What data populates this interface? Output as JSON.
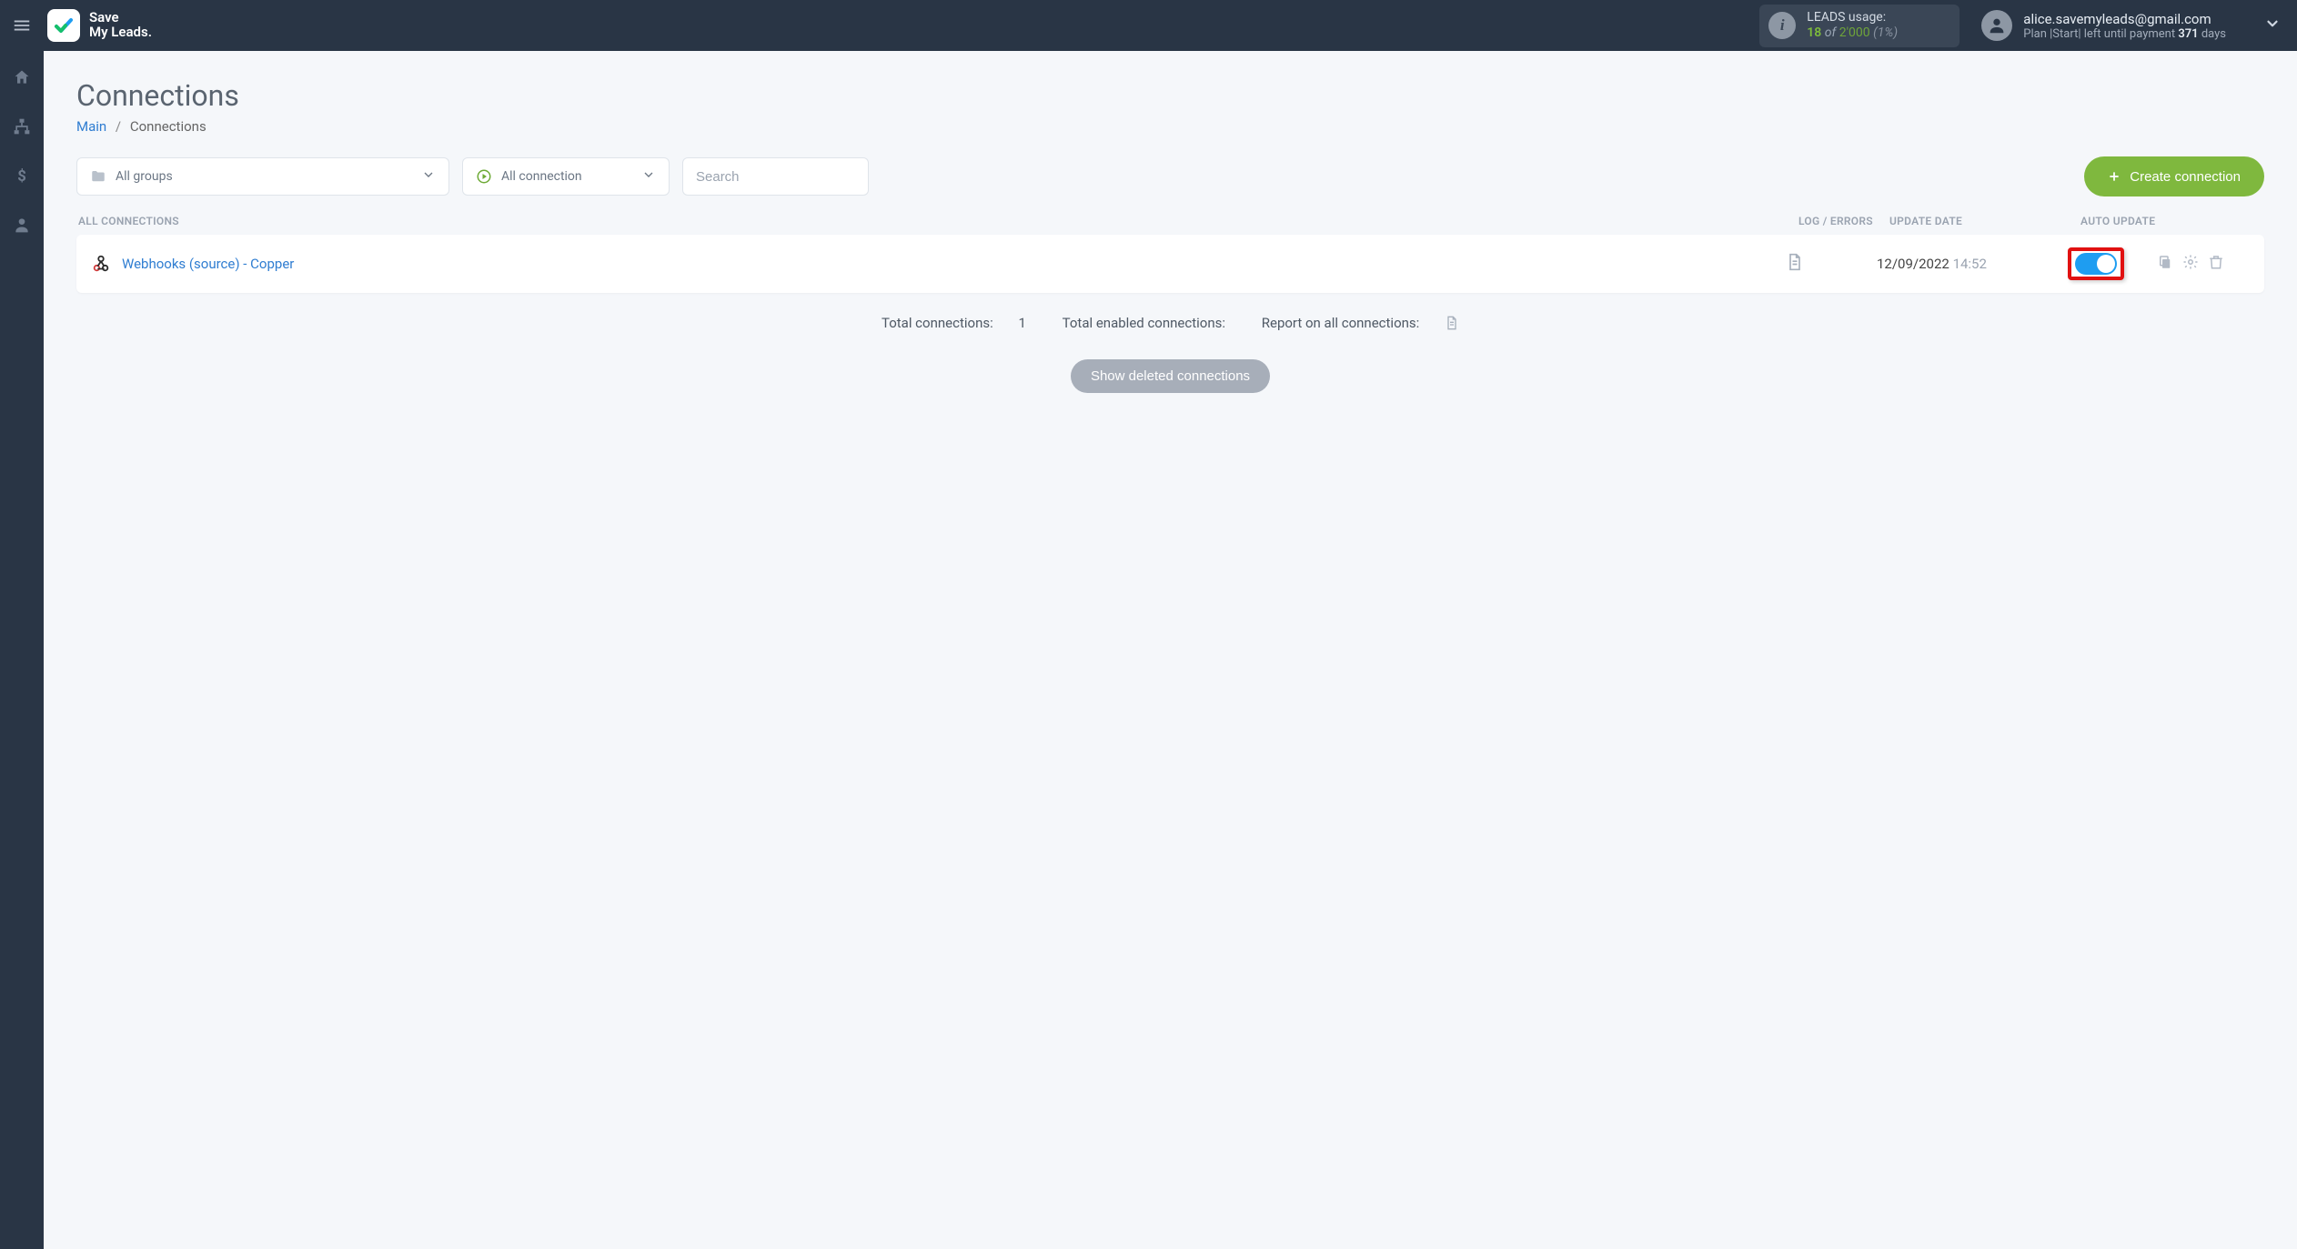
{
  "brand": {
    "line1": "Save",
    "line2": "My Leads."
  },
  "usage": {
    "label": "LEADS usage:",
    "used": "18",
    "of": "of",
    "limit": "2'000",
    "percent": "(1%)"
  },
  "user": {
    "email": "alice.savemyleads@gmail.com",
    "plan_prefix": "Plan |",
    "plan_name": "Start",
    "plan_sep": "|  left until payment",
    "days": "371",
    "days_word": "days"
  },
  "page": {
    "title": "Connections",
    "crumb_main": "Main",
    "crumb_current": "Connections"
  },
  "filters": {
    "groups_label": "All groups",
    "conn_label": "All connection",
    "search_placeholder": "Search",
    "create_label": "Create connection"
  },
  "headers": {
    "all": "ALL CONNECTIONS",
    "log": "LOG / ERRORS",
    "date": "UPDATE DATE",
    "auto": "AUTO UPDATE"
  },
  "row": {
    "name": "Webhooks (source) - Copper",
    "date": "12/09/2022",
    "time": "14:52"
  },
  "summary": {
    "total_label": "Total connections:",
    "total_value": "1",
    "enabled_label": "Total enabled connections:",
    "report_label": "Report on all connections:"
  },
  "buttons": {
    "show_deleted": "Show deleted connections"
  }
}
